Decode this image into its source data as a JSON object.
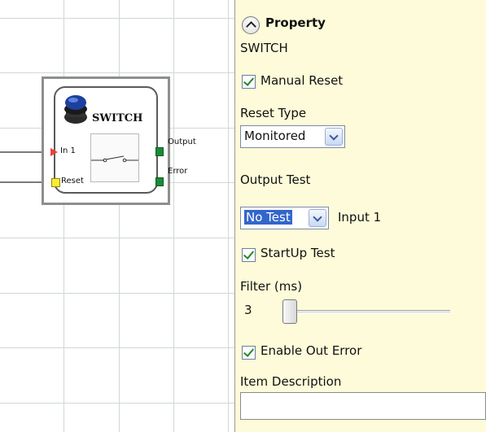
{
  "canvas": {
    "block": {
      "title": "SWITCH",
      "ports": {
        "in1": "In 1",
        "reset": "Reset",
        "output": "Output",
        "error": "Error"
      }
    }
  },
  "panel": {
    "header": "Property",
    "block_type": "SWITCH",
    "manual_reset": {
      "label": "Manual Reset",
      "checked": true
    },
    "reset_type": {
      "label": "Reset Type",
      "value": "Monitored"
    },
    "output_test": {
      "label": "Output Test",
      "value": "No Test",
      "input_label": "Input 1"
    },
    "startup_test": {
      "label": "StartUp Test",
      "checked": true
    },
    "filter": {
      "label": "Filter (ms)",
      "value": "3"
    },
    "enable_out_error": {
      "label": "Enable Out Error",
      "checked": true
    },
    "item_description": {
      "label": "Item Description",
      "value": ""
    }
  },
  "colors": {
    "panel_bg": "#fdfbd9",
    "selection": "#3366cc",
    "port_input": "#e8413a",
    "port_reset": "#ffea3a",
    "port_output": "#1a8a3a"
  },
  "icons": [
    "chevron-up-icon",
    "checkmark-icon",
    "chevron-down-icon",
    "pushbutton-icon",
    "switch-contact-icon"
  ]
}
